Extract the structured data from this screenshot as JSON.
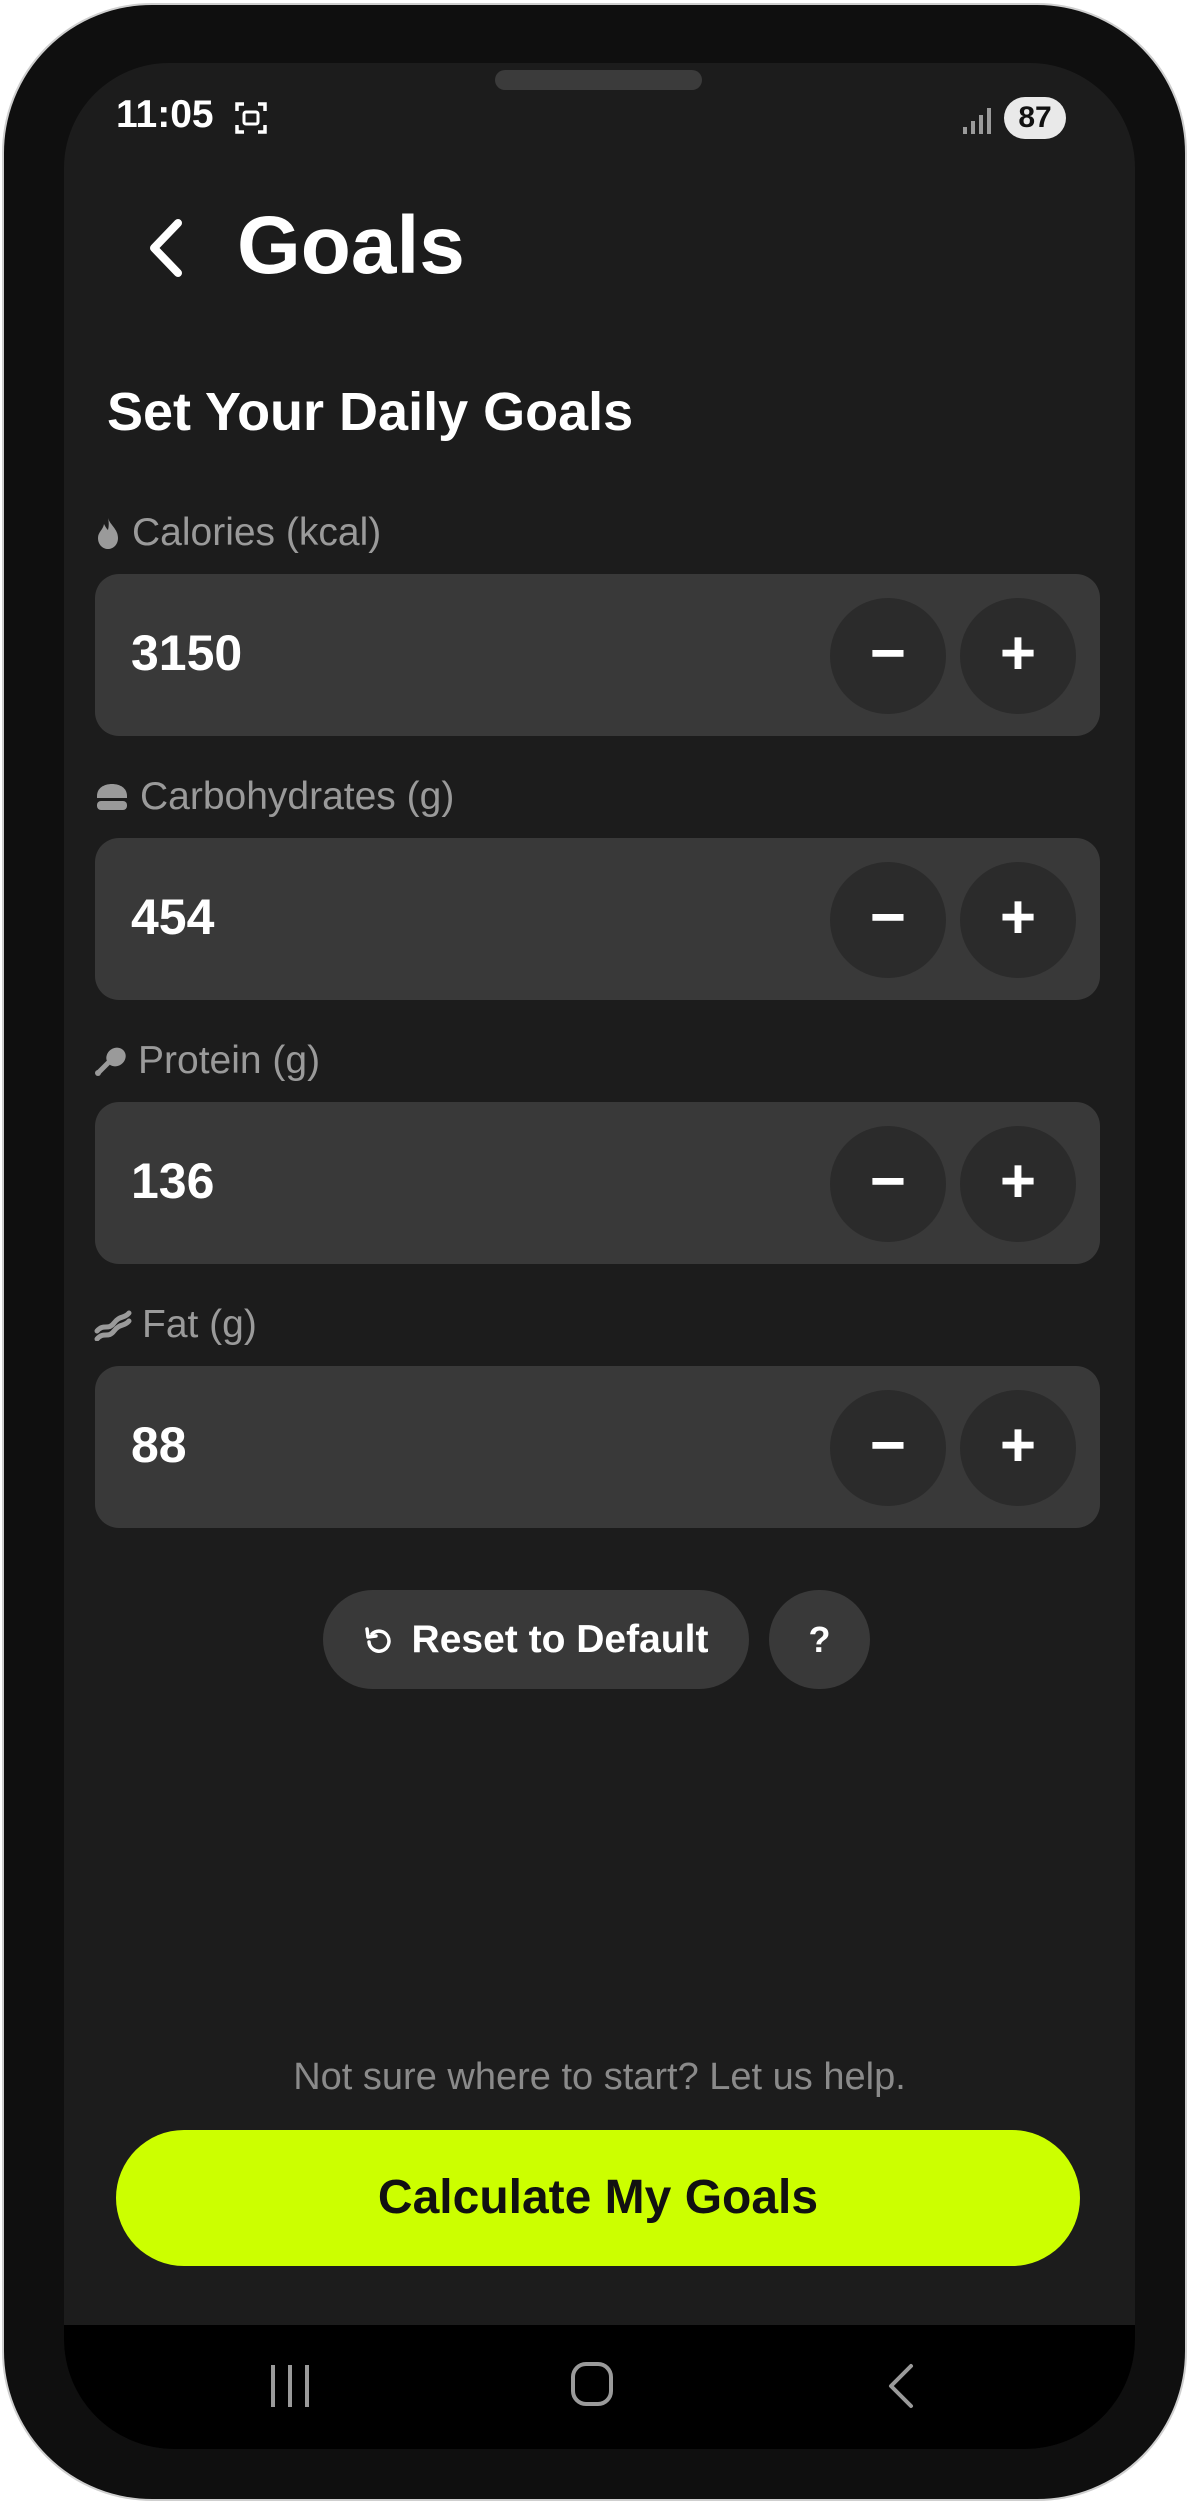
{
  "status_bar": {
    "time": "11:05",
    "battery": "87",
    "icons": [
      "screen-record-icon",
      "signal-icon",
      "battery-icon"
    ]
  },
  "header": {
    "title": "Goals",
    "back_icon": "chevron-left-icon"
  },
  "section": {
    "heading": "Set Your Daily Goals"
  },
  "fields": [
    {
      "label": "Calories (kcal)",
      "value": "3150",
      "icon": "flame-icon",
      "minus": "−",
      "plus": "+"
    },
    {
      "label": "Carbohydrates (g)",
      "value": "454",
      "icon": "bread-icon",
      "minus": "−",
      "plus": "+"
    },
    {
      "label": "Protein (g)",
      "value": "136",
      "icon": "drumstick-icon",
      "minus": "−",
      "plus": "+"
    },
    {
      "label": "Fat (g)",
      "value": "88",
      "icon": "bacon-icon",
      "minus": "−",
      "plus": "+"
    }
  ],
  "actions": {
    "reset_label": "Reset to Default",
    "help_label": "?"
  },
  "footer": {
    "help_text": "Not sure where to start? Let us help.",
    "calculate_label": "Calculate My Goals"
  },
  "colors": {
    "accent": "#ccff00",
    "background": "#1c1c1c",
    "field": "#393939",
    "stepper": "#2b2b2b"
  }
}
